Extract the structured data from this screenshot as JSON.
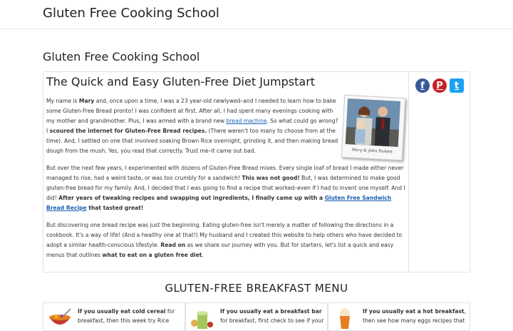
{
  "site": {
    "title": "Gluten Free Cooking School"
  },
  "page": {
    "title": "Gluten Free Cooking School"
  },
  "article": {
    "heading": "The Quick and Easy Gluten-Free Diet Jumpstart",
    "photo_caption": "Mary & John Pickett",
    "p1": {
      "a": "My name is ",
      "b": "Mary",
      "c": " and, once upon a time, I was a 23 year-old newlywed–and I needed to learn how to bake some Gluten-Free Bread pronto! I was confident at first. After all, I had spent many evenings cooking with my mother and grandmother. Plus, I was armed with a brand new ",
      "link": "bread machine",
      "d": ". So what could go wrong? I ",
      "e": "scoured the internet for Gluten-Free Bread recipes.",
      "f": " (There weren't too many to choose from at the time). And, I settled on one that involved soaking Brown Rice overnight, grinding it, and then making bread dough from the mush. Yes, you read that correctly. Trust me–it came out bad."
    },
    "p2": {
      "a": "But over the next few years, I experimented with dozens of Gluten-Free Bread mixes. Every single loaf of bread I made either never managed to rise, had a weird taste, or was too crumbly for a sandwich! ",
      "b": "This was not good!",
      "c": " But, I was determined to make good gluten-free bread for my family. And, I decided that I was going to find a recipe that worked–even if I had to invent one myself. And I did! ",
      "d": "After years of tweaking recipes and swapping out ingredients, I finally came up with a ",
      "link": "Gluten Free Sandwich Bread Recipe",
      "e": " that tasted great!"
    },
    "p3": {
      "a": "But discovering one bread recipe was just the beginning. Eating gluten-free isn't merely a matter of following the directions in a cookbook. It's a way of life! (And a healthy one at that!) My husband and I created this website to help others who have decided to adopt a similar health-conscious lifestyle. ",
      "b": "Read on",
      "c": " as we share our journey with you. But for starters, let's list a quick and easy menus that outlines ",
      "d": "what to eat on a gluten free diet",
      "e": "."
    }
  },
  "share": {
    "icons": [
      {
        "name": "facebook",
        "glyph": "f",
        "color": "#3b5998"
      },
      {
        "name": "pinterest",
        "glyph": "P",
        "color": "#cb2027"
      },
      {
        "name": "twitter",
        "glyph": "t",
        "color": "#1da1f2"
      }
    ]
  },
  "breakfast": {
    "heading": "GLUTEN-FREE BREAKFAST MENU",
    "cards": [
      {
        "bold": "If you usually eat cold cereal",
        "rest": " for breakfast, then this week try Rice"
      },
      {
        "bold": "If you usually eat a breakfast bar",
        "rest": " for breakfast, first check to see if your"
      },
      {
        "bold": "If you usually eat a hot breakfast",
        "rest": ", then see how many eggs recipes that"
      }
    ]
  },
  "colors": {
    "link": "#1a5fb4",
    "border": "#e2e2e2"
  }
}
